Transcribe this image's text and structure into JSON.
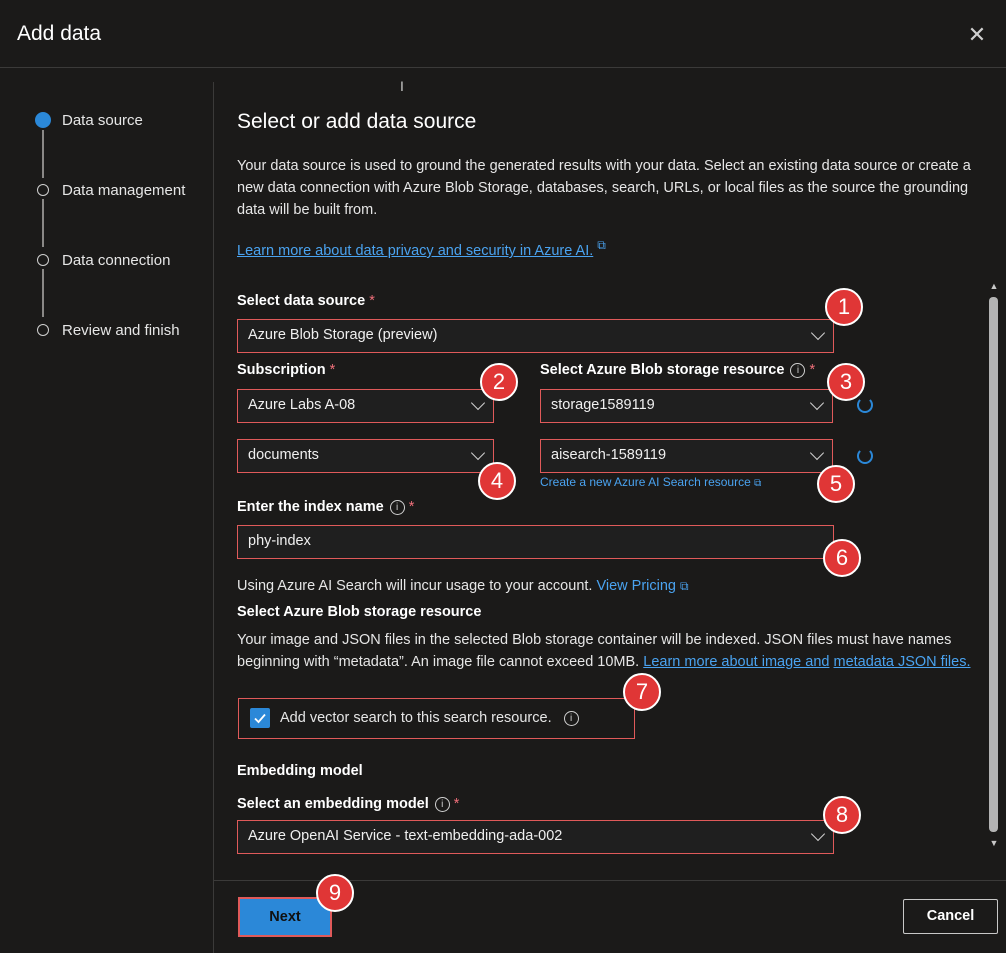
{
  "header": {
    "title": "Add data",
    "close_icon": "close-icon"
  },
  "steps": [
    {
      "label": "Data source",
      "active": true
    },
    {
      "label": "Data management",
      "active": false
    },
    {
      "label": "Data connection",
      "active": false
    },
    {
      "label": "Review and finish",
      "active": false
    }
  ],
  "main": {
    "title": "Select or add data source",
    "description": "Your data source is used to ground the generated results with your data. Select an existing data source or create a new data connection with Azure Blob Storage, databases, search, URLs, or local files as the source the grounding data will be built from.",
    "privacy_link": "Learn more about data privacy and security in Azure AI.",
    "data_source": {
      "label": "Select data source",
      "required": "*",
      "value": "Azure Blob Storage (preview)"
    },
    "subscription": {
      "label": "Subscription",
      "required": "*",
      "value": "Azure Labs A-08"
    },
    "blob_resource": {
      "label": "Select Azure Blob storage resource",
      "required": "*",
      "value": "storage1589119"
    },
    "container": {
      "value": "documents"
    },
    "search_resource": {
      "value": "aisearch-1589119",
      "create_link": "Create a new Azure AI Search resource"
    },
    "index_name": {
      "label": "Enter the index name",
      "required": "*",
      "value": "phy-index"
    },
    "usage_note": "Using Azure AI Search will incur usage to your account.",
    "view_pricing": "View Pricing",
    "blob_section_title": "Select Azure Blob storage resource",
    "blob_section_text": "Your image and JSON files in the selected Blob storage container will be indexed. JSON files must have names beginning with “metadata”. An image file cannot exceed 10MB.",
    "blob_section_link_1": "Learn more about image and",
    "blob_section_link_2": "metadata JSON files.",
    "vector_search": {
      "label": "Add vector search to this search resource.",
      "checked": true
    },
    "embedding_title": "Embedding model",
    "embedding_model": {
      "label": "Select an embedding model",
      "required": "*",
      "value": "Azure OpenAI Service - text-embedding-ada-002"
    }
  },
  "badges": [
    "1",
    "2",
    "3",
    "4",
    "5",
    "6",
    "7",
    "8",
    "9"
  ],
  "footer": {
    "next_label": "Next",
    "cancel_label": "Cancel"
  },
  "colors": {
    "accent": "#2b88d8",
    "highlight": "#e05a5a",
    "badge": "#e03636",
    "background": "#1b1a19"
  }
}
